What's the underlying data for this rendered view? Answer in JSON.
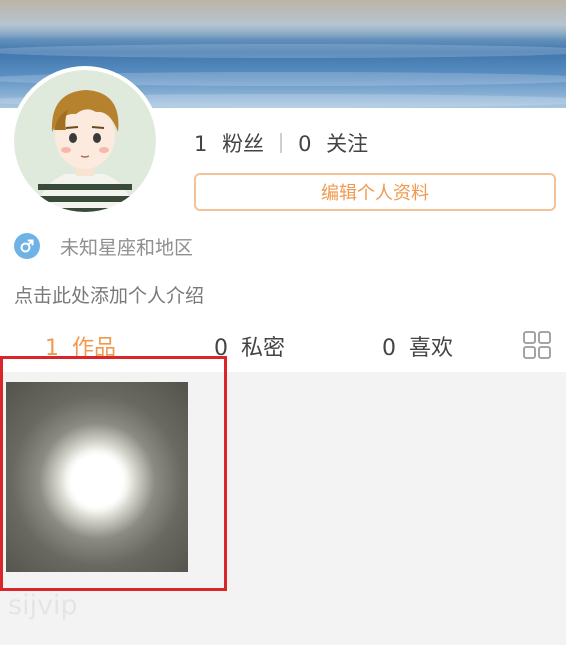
{
  "profile": {
    "followers_count": "1",
    "followers_label": "粉丝",
    "following_count": "0",
    "following_label": "关注",
    "edit_button_label": "编辑个人资料",
    "zodiac_region": "未知星座和地区",
    "intro_placeholder": "点击此处添加个人介绍",
    "gender_icon": "male-icon"
  },
  "tabs": [
    {
      "count": "1",
      "label": "作品",
      "active": true
    },
    {
      "count": "0",
      "label": "私密",
      "active": false
    },
    {
      "count": "0",
      "label": "喜欢",
      "active": false
    }
  ],
  "layout_toggle_icon": "grid-icon",
  "watermark": "sijvip",
  "colors": {
    "accent": "#f19a4f",
    "edit_border": "#f2c39a",
    "highlight_box": "#d8262b",
    "gender_icon_bg": "#6fb3e6",
    "content_bg": "#f3f3f3"
  }
}
